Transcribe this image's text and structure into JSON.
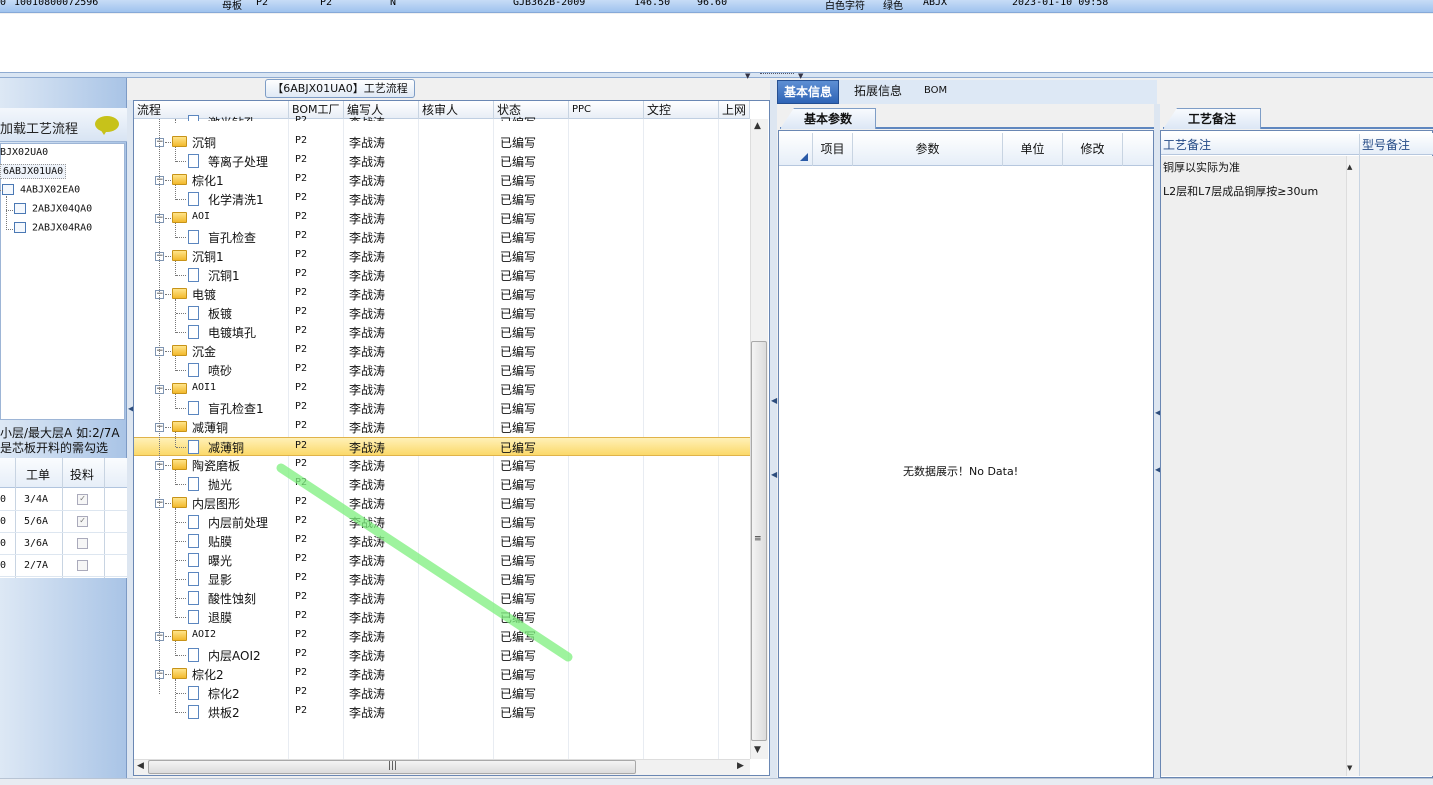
{
  "top_row": {
    "c1": "0",
    "c2": "10010800072596",
    "c3": "母板",
    "c4": "P2",
    "c5": "P2",
    "c6": "N",
    "c7": "GJB362B-2009",
    "c8": "146.50",
    "c9": "96.60",
    "c10": "白色字符",
    "c11": "绿色",
    "c12": "ABJX",
    "c13": "2023-01-10 09:58"
  },
  "left": {
    "load_label": "加载工艺流程",
    "tree": [
      "BJX02UA0",
      "6ABJX01UA0",
      "4ABJX02EA0",
      "2ABJX04QA0",
      "2ABJX04RA0"
    ],
    "hint_line1": "小层/最大层A 如:2/7A",
    "hint_line2": "是芯板开料的需勾选",
    "grid_headers": [
      "工单",
      "投料"
    ],
    "grid_rows": [
      {
        "c0": "0",
        "job": "3/4A",
        "checked": true
      },
      {
        "c0": "0",
        "job": "5/6A",
        "checked": true
      },
      {
        "c0": "0",
        "job": "3/6A",
        "checked": false
      },
      {
        "c0": "0",
        "job": "2/7A",
        "checked": false
      }
    ]
  },
  "middle": {
    "title": "【6ABJX01UA0】工艺流程",
    "headers": [
      "流程",
      "BOM工厂",
      "编写人",
      "核审人",
      "状态",
      "PPC",
      "文控",
      "上网"
    ],
    "rows": [
      {
        "name": "激光钻孔",
        "level": 1,
        "bom": "P2",
        "writer": "李战涛",
        "status": "已编写",
        "partial": true
      },
      {
        "name": "沉铜",
        "level": 0,
        "bom": "P2",
        "writer": "李战涛",
        "status": "已编写"
      },
      {
        "name": "等离子处理",
        "level": 1,
        "bom": "P2",
        "writer": "李战涛",
        "status": "已编写"
      },
      {
        "name": "棕化1",
        "level": 0,
        "bom": "P2",
        "writer": "李战涛",
        "status": "已编写"
      },
      {
        "name": "化学清洗1",
        "level": 1,
        "bom": "P2",
        "writer": "李战涛",
        "status": "已编写"
      },
      {
        "name": "AOI",
        "level": 0,
        "bom": "P2",
        "writer": "李战涛",
        "status": "已编写"
      },
      {
        "name": "盲孔检查",
        "level": 1,
        "bom": "P2",
        "writer": "李战涛",
        "status": "已编写"
      },
      {
        "name": "沉铜1",
        "level": 0,
        "bom": "P2",
        "writer": "李战涛",
        "status": "已编写"
      },
      {
        "name": "沉铜1",
        "level": 1,
        "bom": "P2",
        "writer": "李战涛",
        "status": "已编写"
      },
      {
        "name": "电镀",
        "level": 0,
        "bom": "P2",
        "writer": "李战涛",
        "status": "已编写"
      },
      {
        "name": "板镀",
        "level": 1,
        "bom": "P2",
        "writer": "李战涛",
        "status": "已编写"
      },
      {
        "name": "电镀填孔",
        "level": 1,
        "bom": "P2",
        "writer": "李战涛",
        "status": "已编写"
      },
      {
        "name": "沉金",
        "level": 0,
        "bom": "P2",
        "writer": "李战涛",
        "status": "已编写"
      },
      {
        "name": "喷砂",
        "level": 1,
        "bom": "P2",
        "writer": "李战涛",
        "status": "已编写"
      },
      {
        "name": "AOI1",
        "level": 0,
        "bom": "P2",
        "writer": "李战涛",
        "status": "已编写"
      },
      {
        "name": "盲孔检查1",
        "level": 1,
        "bom": "P2",
        "writer": "李战涛",
        "status": "已编写"
      },
      {
        "name": "减薄铜",
        "level": 0,
        "bom": "P2",
        "writer": "李战涛",
        "status": "已编写"
      },
      {
        "name": "减薄铜",
        "level": 1,
        "bom": "P2",
        "writer": "李战涛",
        "status": "已编写",
        "selected": true
      },
      {
        "name": "陶瓷磨板",
        "level": 0,
        "bom": "P2",
        "writer": "李战涛",
        "status": "已编写"
      },
      {
        "name": "抛光",
        "level": 1,
        "bom": "P2",
        "writer": "李战涛",
        "status": "已编写"
      },
      {
        "name": "内层图形",
        "level": 0,
        "bom": "P2",
        "writer": "李战涛",
        "status": "已编写"
      },
      {
        "name": "内层前处理",
        "level": 1,
        "bom": "P2",
        "writer": "李战涛",
        "status": "已编写"
      },
      {
        "name": "贴膜",
        "level": 1,
        "bom": "P2",
        "writer": "李战涛",
        "status": "已编写"
      },
      {
        "name": "曝光",
        "level": 1,
        "bom": "P2",
        "writer": "李战涛",
        "status": "已编写"
      },
      {
        "name": "显影",
        "level": 1,
        "bom": "P2",
        "writer": "李战涛",
        "status": "已编写"
      },
      {
        "name": "酸性蚀刻",
        "level": 1,
        "bom": "P2",
        "writer": "李战涛",
        "status": "已编写"
      },
      {
        "name": "退膜",
        "level": 1,
        "bom": "P2",
        "writer": "李战涛",
        "status": "已编写"
      },
      {
        "name": "AOI2",
        "level": 0,
        "bom": "P2",
        "writer": "李战涛",
        "status": "已编写"
      },
      {
        "name": "内层AOI2",
        "level": 1,
        "bom": "P2",
        "writer": "李战涛",
        "status": "已编写"
      },
      {
        "name": "棕化2",
        "level": 0,
        "bom": "P2",
        "writer": "李战涛",
        "status": "已编写"
      },
      {
        "name": "棕化2",
        "level": 1,
        "bom": "P2",
        "writer": "李战涛",
        "status": "已编写"
      },
      {
        "name": "烘板2",
        "level": 1,
        "bom": "P2",
        "writer": "李战涛",
        "status": "已编写"
      }
    ]
  },
  "info": {
    "tabs": [
      "基本信息",
      "拓展信息",
      "BOM"
    ],
    "subtab": "基本参数",
    "headers": [
      "项目",
      "参数",
      "单位",
      "修改"
    ],
    "empty": "无数据展示！No Data!"
  },
  "notes": {
    "tab": "工艺备注",
    "headers": [
      "工艺备注",
      "型号备注"
    ],
    "lines": [
      "铜厚以实际为准",
      "L2层和L7层成品铜厚按≥30um"
    ]
  },
  "colors": {
    "accent": "#2f64b6",
    "selection": "#fbd96a",
    "annotation": "#7ef07e"
  }
}
